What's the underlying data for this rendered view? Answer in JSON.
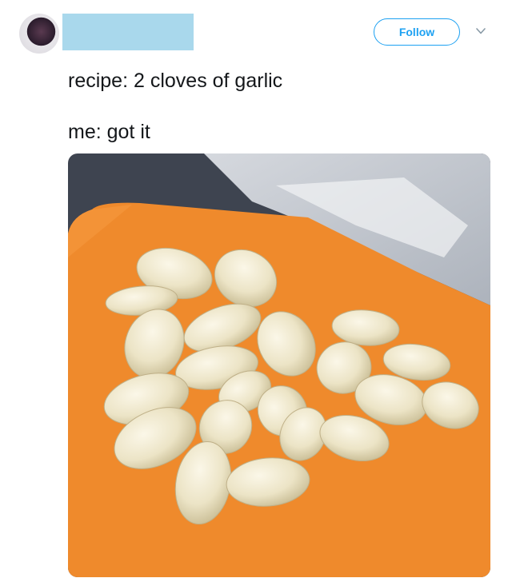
{
  "tweet": {
    "follow_label": "Follow",
    "lines": [
      "recipe: 2 cloves of garlic",
      "me: got it"
    ]
  },
  "icons": {
    "chevron": "chevron-down-icon"
  },
  "colors": {
    "accent": "#1da1f2",
    "redaction": "#a9d8ec",
    "text": "#14171a",
    "cutting_board": "#ef8a2c"
  }
}
